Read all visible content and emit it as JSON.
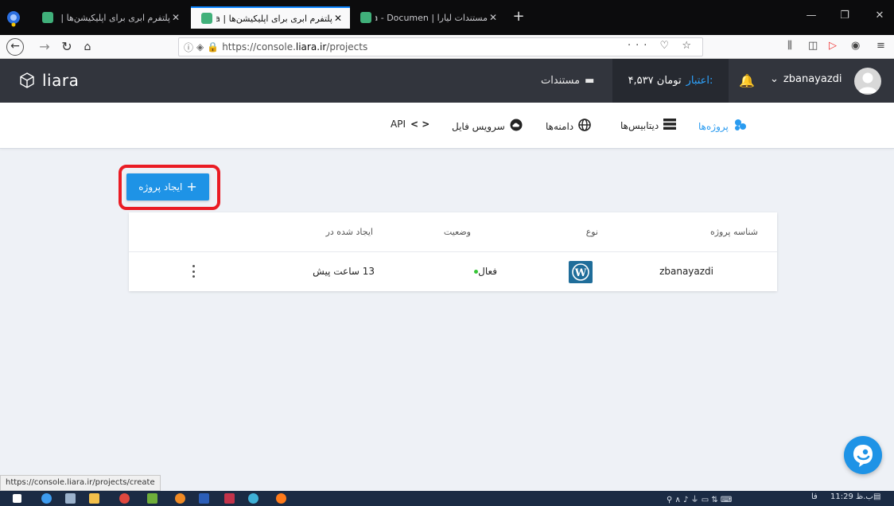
{
  "browser": {
    "tabs": [
      {
        "title": "پلتفرم ابری برای اپلیکیشن‌ها | Liara"
      },
      {
        "title": "پلتفرم ابری برای اپلیکیشن‌ها | Liara"
      },
      {
        "title": "مستندات لیارا | Liara - Documen"
      }
    ],
    "new_tab": "+",
    "url_scheme": "https://console.",
    "url_host": "liara.ir",
    "url_path": "/projects",
    "page_actions": "··· ♡ ☆"
  },
  "header": {
    "logo_text": "liara",
    "docs_label": "مستندات",
    "credit_label": "اعتبار:",
    "credit_value": "۴,۵۳۷ تومان",
    "username": "zbanayazdi"
  },
  "subnav": {
    "projects": "پروژه‌ها",
    "databases": "دیتابیس‌ها",
    "domains": "دامنه‌ها",
    "file_service": "سرویس فایل",
    "api": "API"
  },
  "main": {
    "create_button": "ایجاد پروژه",
    "table": {
      "headers": {
        "project_id": "شناسه پروژه",
        "type": "نوع",
        "status": "وضعیت",
        "created": "ایجاد شده در"
      },
      "rows": [
        {
          "project_id": "zbanayazdi",
          "type": "wordpress",
          "status": "فعال",
          "created": "13 ساعت پیش"
        }
      ]
    }
  },
  "statusbar": {
    "link": "https://console.liara.ir/projects/create"
  },
  "taskbar": {
    "time": "11:29 ب.ظ",
    "lang": "فا"
  },
  "colors": {
    "accent": "#1e93e6",
    "header_bg": "#32353d",
    "highlight": "#ea1c24",
    "active_dot": "#37c537"
  }
}
